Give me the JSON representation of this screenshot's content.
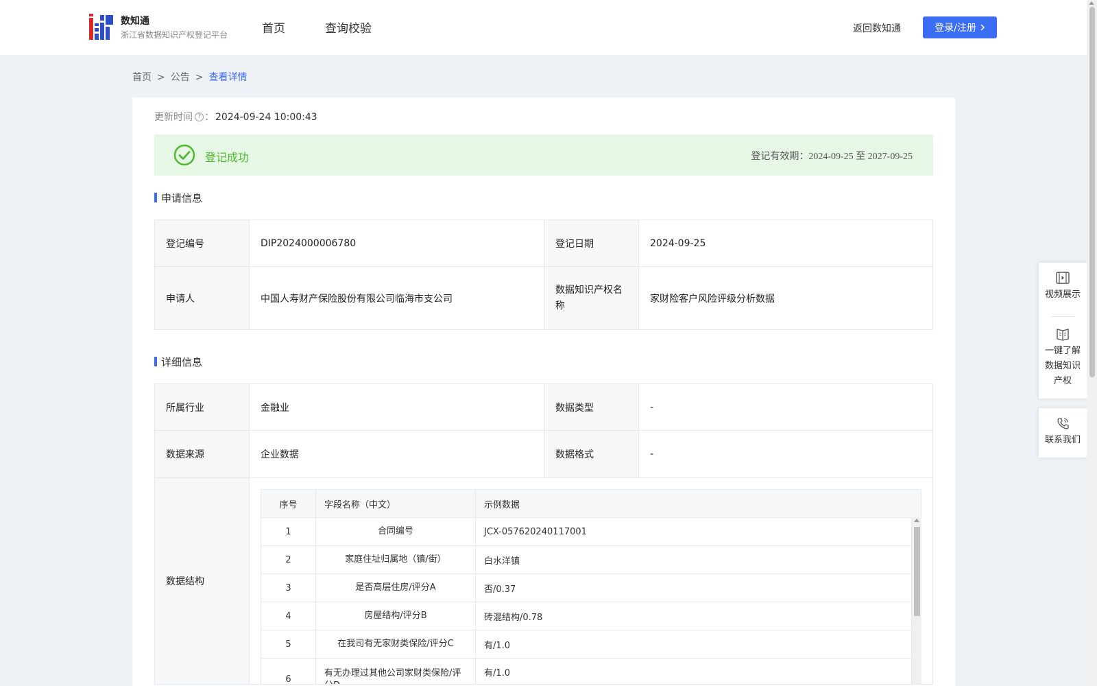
{
  "brand": {
    "name": "数知通",
    "subtitle": "浙江省数据知识产权登记平台",
    "colors": {
      "blue": "#2c4fc7",
      "red": "#d62b2b"
    }
  },
  "nav": {
    "home": "首页",
    "query": "查询校验"
  },
  "header": {
    "back_label": "返回数知通",
    "login_label": "登录/注册",
    "login_color": "#3a6cf4"
  },
  "breadcrumb": {
    "home": "首页",
    "sep": ">",
    "notice": "公告",
    "current": "查看详情"
  },
  "update": {
    "label": "更新时间",
    "colon": "：",
    "value": "2024-09-24 10:00:43"
  },
  "status": {
    "text": "登记成功",
    "validity_label": "登记有效期：",
    "validity_value": "2024-09-25 至 2027-09-25",
    "color": "#4cb82e",
    "bg": "#e6f7e6"
  },
  "application": {
    "title": "申请信息",
    "reg_no_label": "登记编号",
    "reg_no": "DIP2024000006780",
    "reg_date_label": "登记日期",
    "reg_date": "2024-09-25",
    "applicant_label": "申请人",
    "applicant": "中国人寿财产保险股份有限公司临海市支公司",
    "ip_name_label": "数据知识产权名称",
    "ip_name": "家财险客户风险评级分析数据"
  },
  "details": {
    "title": "详细信息",
    "industry_label": "所属行业",
    "industry": "金融业",
    "data_type_label": "数据类型",
    "data_type": "-",
    "source_label": "数据来源",
    "source": "企业数据",
    "format_label": "数据格式",
    "format": "-",
    "structure_label": "数据结构",
    "structure": {
      "headers": [
        "序号",
        "字段名称（中文）",
        "示例数据"
      ],
      "rows": [
        {
          "no": "1",
          "field": "合同编号",
          "sample": "JCX-057620240117001"
        },
        {
          "no": "2",
          "field": "家庭住址归属地（镇/街）",
          "sample": "白水洋镇"
        },
        {
          "no": "3",
          "field": "是否高层住房/评分A",
          "sample": "否/0.37"
        },
        {
          "no": "4",
          "field": "房屋结构/评分B",
          "sample": "砖混结构/0.78"
        },
        {
          "no": "5",
          "field": "在我司有无家财类保险/评分C",
          "sample": "有/1.0"
        },
        {
          "no": "6",
          "field": "有无办理过其他公司家财类保险/评分D",
          "sample": "有/1.0"
        }
      ]
    }
  },
  "side_panel": {
    "video": "视频展示",
    "learn": [
      "一键了解",
      "数据知识",
      "产权"
    ],
    "contact": "联系我们"
  }
}
